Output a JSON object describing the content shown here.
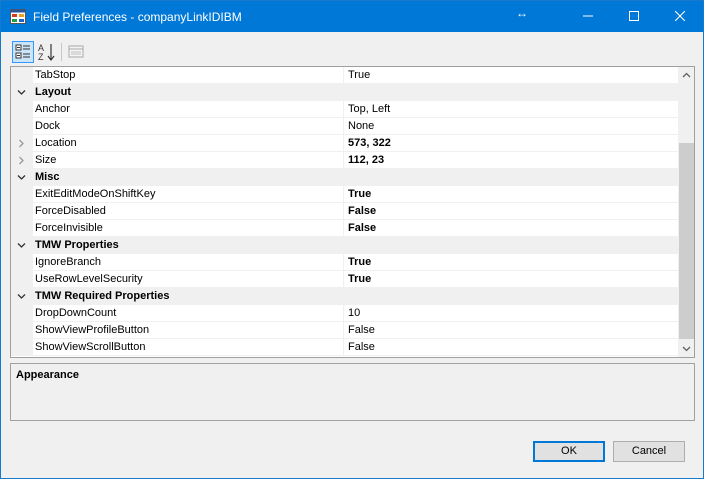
{
  "window": {
    "title": "Field Preferences - companyLinkIDIBM"
  },
  "toolbar": {
    "categorized_icon": "categorized-icon",
    "alphabetical_icon": "alphabetical-icon",
    "property_pages_icon": "property-pages-icon"
  },
  "grid": {
    "rows": [
      {
        "type": "prop",
        "name": "TabStop",
        "value": "True",
        "bold": false
      },
      {
        "type": "cat",
        "name": "Layout"
      },
      {
        "type": "prop",
        "name": "Anchor",
        "value": "Top, Left",
        "bold": false
      },
      {
        "type": "prop",
        "name": "Dock",
        "value": "None",
        "bold": false
      },
      {
        "type": "prop",
        "name": "Location",
        "value": "573, 322",
        "bold": true,
        "expandable": true
      },
      {
        "type": "prop",
        "name": "Size",
        "value": "112, 23",
        "bold": true,
        "expandable": true
      },
      {
        "type": "cat",
        "name": "Misc"
      },
      {
        "type": "prop",
        "name": "ExitEditModeOnShiftKey",
        "value": "True",
        "bold": true
      },
      {
        "type": "prop",
        "name": "ForceDisabled",
        "value": "False",
        "bold": true
      },
      {
        "type": "prop",
        "name": "ForceInvisible",
        "value": "False",
        "bold": true
      },
      {
        "type": "cat",
        "name": "TMW Properties"
      },
      {
        "type": "prop",
        "name": "IgnoreBranch",
        "value": "True",
        "bold": true
      },
      {
        "type": "prop",
        "name": "UseRowLevelSecurity",
        "value": "True",
        "bold": true
      },
      {
        "type": "cat",
        "name": "TMW Required Properties"
      },
      {
        "type": "prop",
        "name": "DropDownCount",
        "value": "10",
        "bold": false
      },
      {
        "type": "prop",
        "name": "ShowViewProfileButton",
        "value": "False",
        "bold": false
      },
      {
        "type": "prop",
        "name": "ShowViewScrollButton",
        "value": "False",
        "bold": false
      }
    ]
  },
  "help": {
    "title": "Appearance"
  },
  "buttons": {
    "ok": "OK",
    "cancel": "Cancel"
  },
  "colors": {
    "titlebar": "#0078d7",
    "selected_tool": "#cce4f7"
  }
}
